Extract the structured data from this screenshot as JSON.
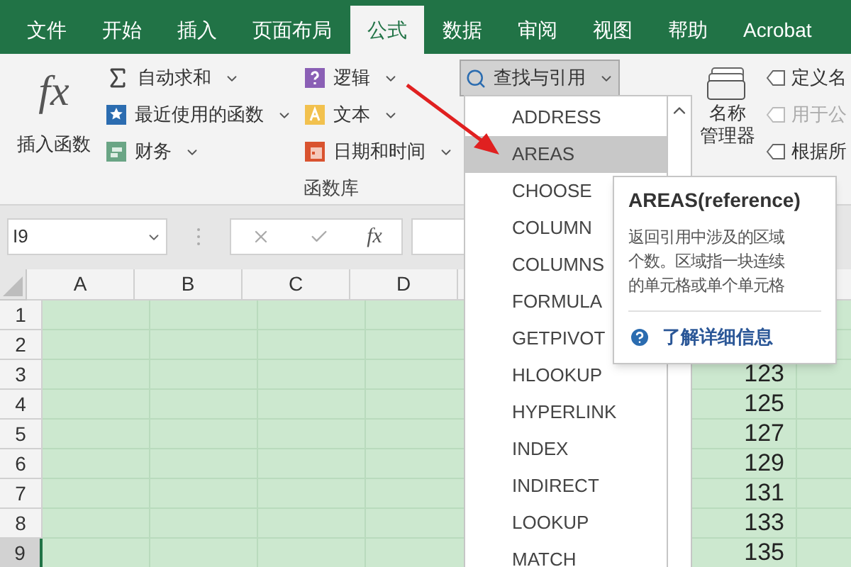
{
  "tabs": [
    {
      "label": "文件",
      "selected": false
    },
    {
      "label": "开始",
      "selected": false
    },
    {
      "label": "插入",
      "selected": false
    },
    {
      "label": "页面布局",
      "selected": false
    },
    {
      "label": "公式",
      "selected": true
    },
    {
      "label": "数据",
      "selected": false
    },
    {
      "label": "审阅",
      "selected": false
    },
    {
      "label": "视图",
      "selected": false
    },
    {
      "label": "帮助",
      "selected": false
    },
    {
      "label": "Acrobat",
      "selected": false
    }
  ],
  "ribbon": {
    "insert_function": {
      "icon_text": "fx",
      "label": "插入函数"
    },
    "function_library": {
      "label": "函数库",
      "items": [
        {
          "kind": "sum",
          "label": "自动求和"
        },
        {
          "kind": "recent",
          "label": "最近使用的函数"
        },
        {
          "kind": "financial",
          "label": "财务"
        },
        {
          "kind": "logical",
          "label": "逻辑"
        },
        {
          "kind": "text",
          "label": "文本"
        },
        {
          "kind": "datetime",
          "label": "日期和时间"
        }
      ],
      "lookup_button": {
        "label": "查找与引用",
        "expanded": true
      }
    },
    "defined_names": {
      "name_manager": [
        "名称",
        "管理器"
      ],
      "items": [
        {
          "label": "定义名",
          "disabled": false
        },
        {
          "label": "用于公",
          "disabled": true
        },
        {
          "label": "根据所",
          "disabled": false
        }
      ]
    }
  },
  "formula_bar": {
    "name_box": "I9",
    "fx": "fx"
  },
  "sheet": {
    "columns": [
      "A",
      "B",
      "C",
      "D"
    ],
    "rows": [
      {
        "number": "1",
        "selected": false
      },
      {
        "number": "2",
        "selected": false
      },
      {
        "number": "3",
        "selected": false,
        "value": "123"
      },
      {
        "number": "4",
        "selected": false,
        "value": "125"
      },
      {
        "number": "5",
        "selected": false,
        "value": "127"
      },
      {
        "number": "6",
        "selected": false,
        "value": "129"
      },
      {
        "number": "7",
        "selected": false,
        "value": "131"
      },
      {
        "number": "8",
        "selected": false,
        "value": "133"
      },
      {
        "number": "9",
        "selected": true,
        "value": "135"
      }
    ]
  },
  "lookup_menu": {
    "items": [
      {
        "label": "ADDRESS",
        "selected": false
      },
      {
        "label": "AREAS",
        "selected": true
      },
      {
        "label": "CHOOSE",
        "selected": false
      },
      {
        "label": "COLUMN",
        "selected": false
      },
      {
        "label": "COLUMNS",
        "selected": false
      },
      {
        "label": "FORMULA",
        "selected": false
      },
      {
        "label": "GETPIVOT",
        "selected": false
      },
      {
        "label": "HLOOKUP",
        "selected": false
      },
      {
        "label": "HYPERLINK",
        "selected": false
      },
      {
        "label": "INDEX",
        "selected": false
      },
      {
        "label": "INDIRECT",
        "selected": false
      },
      {
        "label": "LOOKUP",
        "selected": false
      },
      {
        "label": "MATCH",
        "selected": false
      }
    ]
  },
  "tooltip": {
    "title": "AREAS(reference)",
    "description": "返回引用中涉及的区域个数。区域指一块连续的单元格或单个单元格",
    "link": "了解详细信息"
  }
}
